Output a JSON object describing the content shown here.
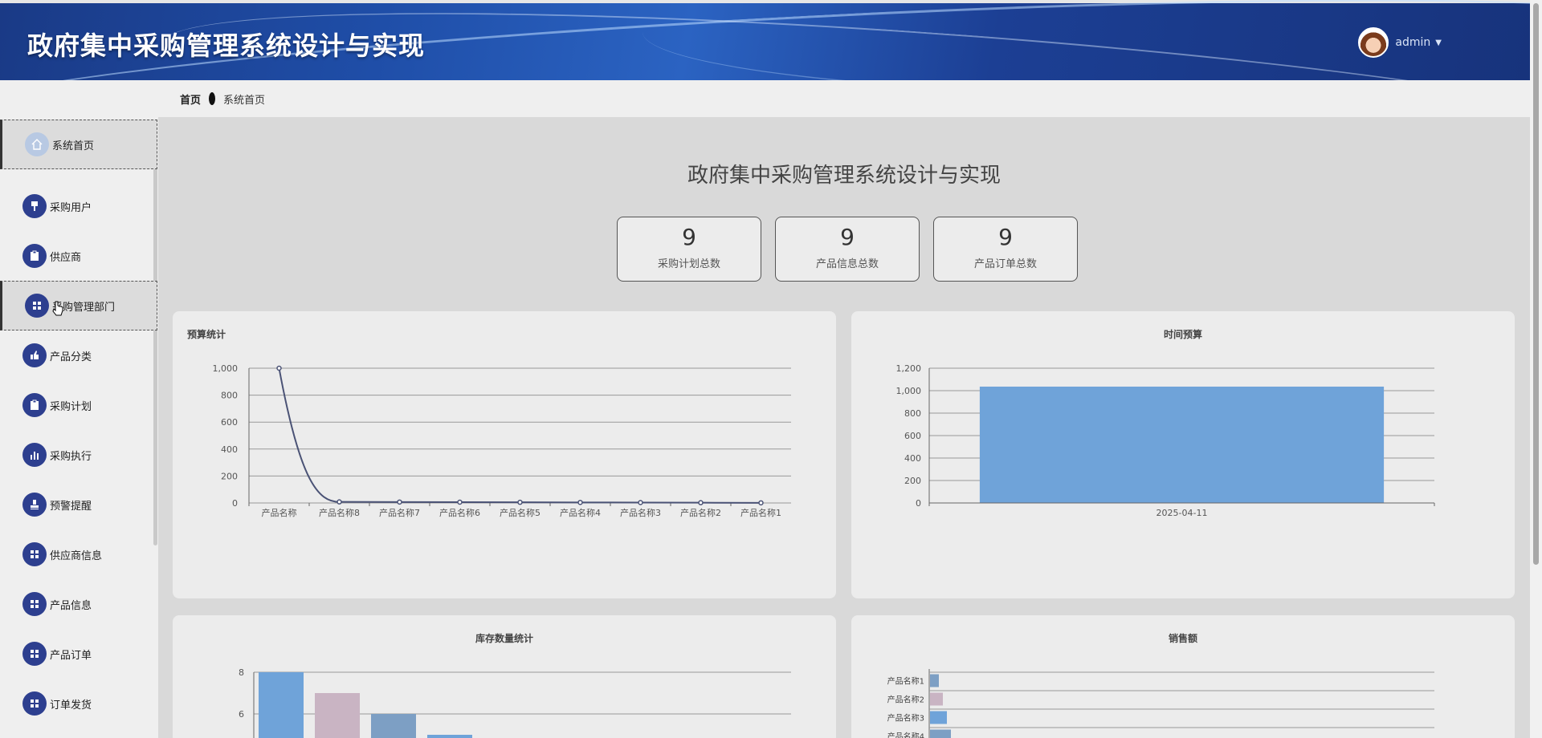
{
  "header": {
    "title": "政府集中采购管理系统设计与实现",
    "user": "admin"
  },
  "breadcrumb": {
    "home": "首页",
    "current": "系统首页"
  },
  "sidebar": {
    "items": [
      {
        "label": "系统首页",
        "icon": "home-icon"
      },
      {
        "label": "采购用户",
        "icon": "brush-icon"
      },
      {
        "label": "供应商",
        "icon": "clipboard-icon"
      },
      {
        "label": "采购管理部门",
        "icon": "grid-icon"
      },
      {
        "label": "产品分类",
        "icon": "thumb-icon"
      },
      {
        "label": "采购计划",
        "icon": "clipboard-icon"
      },
      {
        "label": "采购执行",
        "icon": "bar-chart-icon"
      },
      {
        "label": "预警提醒",
        "icon": "stamp-icon"
      },
      {
        "label": "供应商信息",
        "icon": "grid-icon"
      },
      {
        "label": "产品信息",
        "icon": "grid-icon"
      },
      {
        "label": "产品订单",
        "icon": "grid-icon"
      },
      {
        "label": "订单发货",
        "icon": "grid-icon"
      }
    ]
  },
  "main": {
    "title": "政府集中采购管理系统设计与实现",
    "stats": [
      {
        "value": "9",
        "label": "采购计划总数"
      },
      {
        "value": "9",
        "label": "产品信息总数"
      },
      {
        "value": "9",
        "label": "产品订单总数"
      }
    ]
  },
  "colors": {
    "accent": "#2d3f8f",
    "line": "#4a5275",
    "bar_blue": "#6fa3d9",
    "bar_pink": "#c9b4c3",
    "bar_steel": "#7d9fc4"
  },
  "chart_data": [
    {
      "type": "line",
      "title": "预算统计",
      "categories": [
        "产品名称",
        "产品名称8",
        "产品名称7",
        "产品名称6",
        "产品名称5",
        "产品名称4",
        "产品名称3",
        "产品名称2",
        "产品名称1"
      ],
      "values": [
        1000,
        8,
        7,
        6,
        5,
        4,
        3,
        2,
        1
      ],
      "ylim": [
        0,
        1000
      ],
      "yticks": [
        "0",
        "200",
        "400",
        "600",
        "800",
        "1,000"
      ],
      "grid": true
    },
    {
      "type": "bar",
      "title": "时间预算",
      "categories": [
        "2025-04-11"
      ],
      "values": [
        1036
      ],
      "ylim": [
        0,
        1200
      ],
      "yticks": [
        "0",
        "200",
        "400",
        "600",
        "800",
        "1,000",
        "1,200"
      ],
      "grid": true
    },
    {
      "type": "bar",
      "title": "库存数量统计",
      "values": [
        8,
        7,
        6,
        5
      ],
      "ylim": [
        0,
        8
      ],
      "yticks": [
        "6",
        "8"
      ],
      "grid": true
    },
    {
      "type": "bar",
      "title": "销售额",
      "orientation": "horizontal",
      "categories": [
        "产品名称1",
        "产品名称2",
        "产品名称3",
        "产品名称4"
      ],
      "values": [
        1,
        2,
        3,
        4
      ],
      "grid": true
    }
  ]
}
